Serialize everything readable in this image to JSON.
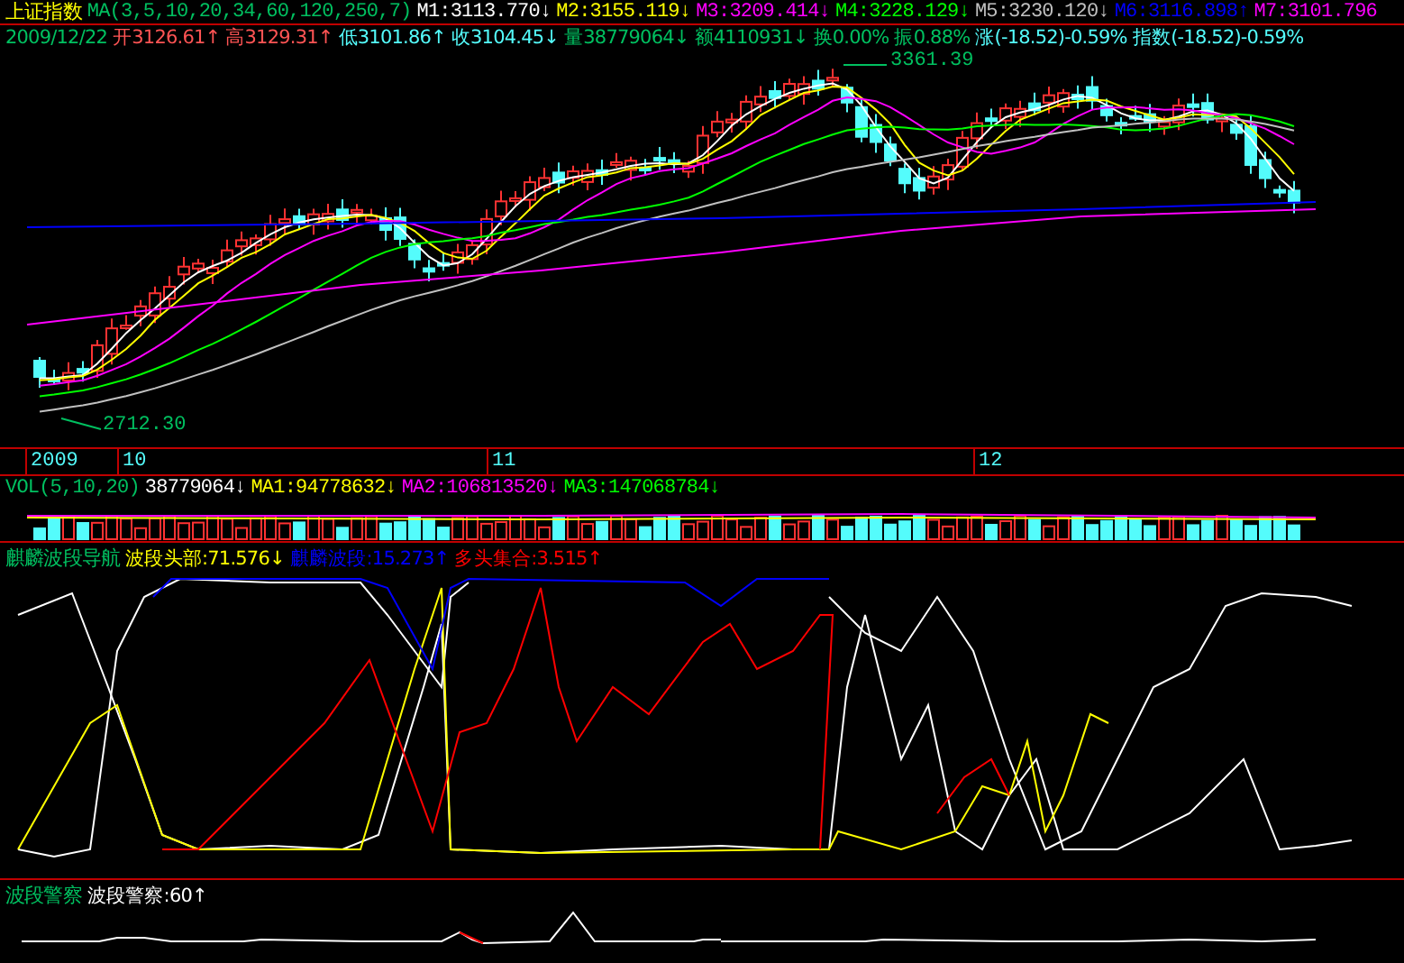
{
  "header": {
    "title": "上证指数",
    "ma_label": "MA(3,5,10,20,34,60,120,250,7)",
    "ma_values": [
      {
        "text": "M1:3113.770↓",
        "color": "#ffffff"
      },
      {
        "text": "M2:3155.119↓",
        "color": "#ffff00"
      },
      {
        "text": "M3:3209.414↓",
        "color": "#ff00ff"
      },
      {
        "text": "M4:3228.129↓",
        "color": "#00ff00"
      },
      {
        "text": "M5:3230.120↓",
        "color": "#c0c0c0"
      },
      {
        "text": "M6:3116.898↑",
        "color": "#0000ff"
      },
      {
        "text": "M7:3101.796",
        "color": "#ff00ff"
      }
    ]
  },
  "quote": [
    {
      "text": "2009/12/22",
      "color": "#00c060"
    },
    {
      "text": "开3126.61↑",
      "color": "#ff5454"
    },
    {
      "text": "高3129.31↑",
      "color": "#ff5454"
    },
    {
      "text": "低3101.86↑",
      "color": "#54fcfc"
    },
    {
      "text": "收3104.45↓",
      "color": "#54fcfc"
    },
    {
      "text": "量38779064↓",
      "color": "#00c060"
    },
    {
      "text": "额4110931↓",
      "color": "#00c060"
    },
    {
      "text": "换0.00%",
      "color": "#00c060"
    },
    {
      "text": "振0.88%",
      "color": "#00c060"
    },
    {
      "text": "涨(-18.52)-0.59%",
      "color": "#54fcfc"
    },
    {
      "text": "指数(-18.52)-0.59%",
      "color": "#54fcfc"
    }
  ],
  "price_chart": {
    "high_label": "3361.39",
    "low_label": "2712.30"
  },
  "time_axis": [
    "2009",
    "10",
    "11",
    "12"
  ],
  "volume": {
    "title": "VOL(5,10,20)",
    "values": [
      {
        "text": "38779064↓",
        "color": "#ffffff"
      },
      {
        "text": "MA1:94778632↓",
        "color": "#ffff00"
      },
      {
        "text": "MA2:106813520↓",
        "color": "#ff00ff"
      },
      {
        "text": "MA3:147068784↓",
        "color": "#00ff00"
      }
    ]
  },
  "indicator": {
    "title": "麒麟波段导航",
    "values": [
      {
        "text": "波段头部:71.576↓",
        "color": "#ffff00"
      },
      {
        "text": "麒麟波段:15.273↑",
        "color": "#0000ff"
      },
      {
        "text": "多头集合:3.515↑",
        "color": "#ff0000"
      }
    ]
  },
  "warning": {
    "title": "波段警察",
    "values": [
      {
        "text": "波段警察:60↑",
        "color": "#ffffff"
      }
    ]
  }
}
